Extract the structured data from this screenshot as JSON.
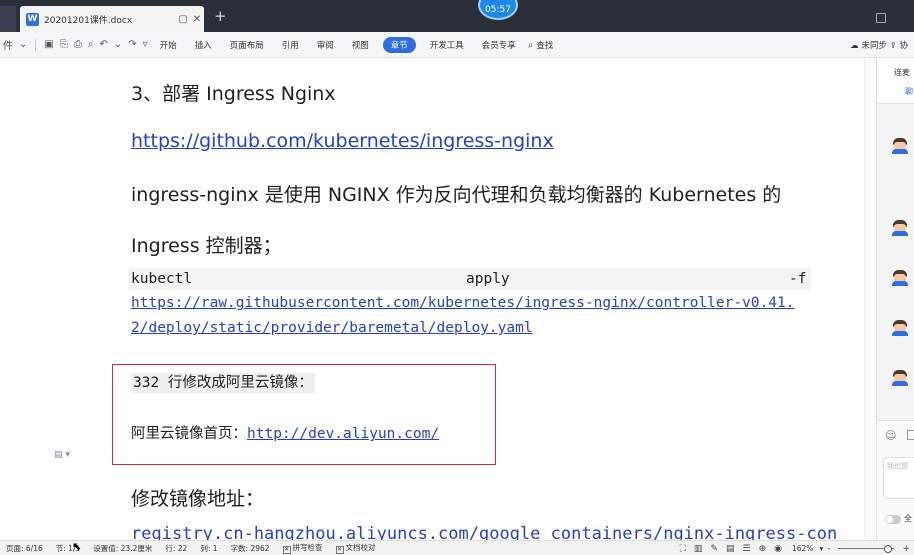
{
  "tabbar": {
    "doc_tab_title": "20201201课件.docx",
    "clock": "05:57",
    "new_tab": "+"
  },
  "toolbar": {
    "file_label": "件",
    "menus": [
      "开始",
      "插入",
      "页面布局",
      "引用",
      "审阅",
      "视图",
      "章节",
      "开发工具",
      "会员专享"
    ],
    "active_menu": "章节",
    "search_label": "查找",
    "sync_label": "未同步",
    "sync_extra": "协"
  },
  "document": {
    "heading": "3、部署 Ingress Nginx",
    "link1": "https://github.com/kubernetes/ingress-nginx",
    "para_line1": "ingress-nginx 是使用 NGINX 作为反向代理和负载均衡器的 Kubernetes 的",
    "para_line2": "Ingress 控制器；",
    "code": {
      "cmd": "kubectl",
      "sub": "apply",
      "flag": "-f",
      "url_line1": "https://raw.githubusercontent.com/kubernetes/ingress-nginx/controller-v0.41.",
      "url_line2": "2/deploy/static/provider/baremetal/deploy.yaml"
    },
    "box": {
      "line1": "332 行修改成阿里云镜像：",
      "line2_label": "阿里云镜像首页：",
      "line2_link": "http://dev.aliyun.com/"
    },
    "subheading": "修改镜像地址：",
    "partial_line": "registry.cn-hangzhou.aliyuncs.com/google_containers/nginx-ingress-con"
  },
  "side_panel": {
    "title": "连麦",
    "tab": "聊",
    "ask_placeholder": "我也想",
    "toggle_label": "全"
  },
  "statusbar": {
    "page": "页面: 6/16",
    "section": "节: 1/1",
    "setting": "设置值: 23.2厘米",
    "row": "行: 22",
    "col": "列: 1",
    "words": "字数: 2962",
    "spell_check": "拼写检查",
    "proofread": "文档校对",
    "zoom": "162%",
    "zoom_out": "-",
    "zoom_in": "+"
  }
}
